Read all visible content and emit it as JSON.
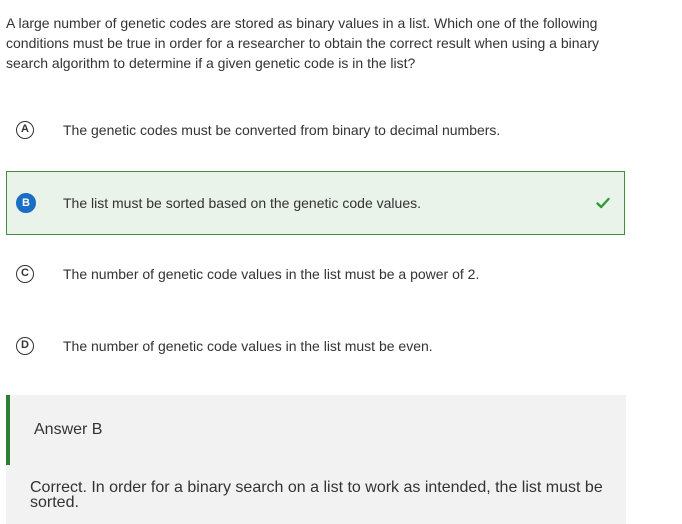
{
  "question": {
    "text": "A large number of genetic codes are stored as binary values in a list. Which one of the following conditions must be true in order for a researcher to obtain the correct result when using a binary search algorithm to determine if a given genetic code is in the list?"
  },
  "options": [
    {
      "letter": "A",
      "text": "The genetic codes must be converted from binary to decimal numbers.",
      "selected": false
    },
    {
      "letter": "B",
      "text": "The list must be sorted based on the genetic code values.",
      "selected": true,
      "correct": true
    },
    {
      "letter": "C",
      "text": "The number of genetic code values in the list must be a power of 2.",
      "selected": false
    },
    {
      "letter": "D",
      "text": "The number of genetic code values in the list must be even.",
      "selected": false
    }
  ],
  "answer": {
    "label": "Answer B",
    "explanation": "Correct. In order for a binary search on a list to work as intended, the list must be sorted."
  },
  "icons": {
    "correct_marker": "check-icon"
  },
  "colors": {
    "selected_background": "#e9f3e9",
    "selected_border": "#3f8f3f",
    "selected_badge": "#1a6fc4",
    "check": "#2e9b3a",
    "answer_accent": "#2e7d32",
    "answer_background": "#f2f2f2"
  }
}
